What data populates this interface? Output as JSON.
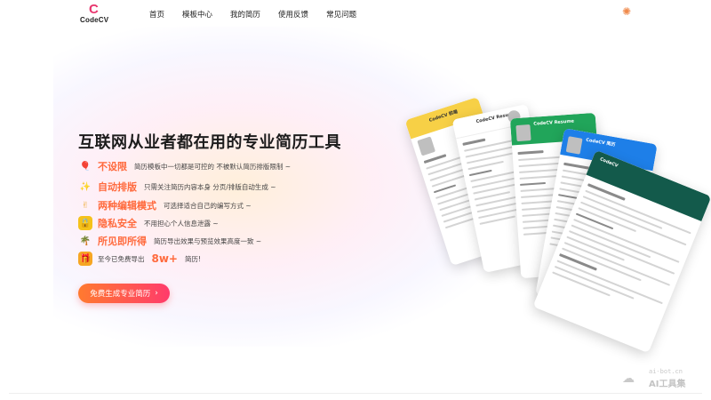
{
  "brand": {
    "logo_letter": "C",
    "logo_text": "CodeCV"
  },
  "nav": {
    "items": [
      "首页",
      "模板中心",
      "我的简历",
      "使用反馈",
      "常见问题"
    ]
  },
  "hero": {
    "headline": "互联网从业者都在用的专业简历工具",
    "features": [
      {
        "icon": "balloon-icon",
        "title": "不设限",
        "desc": "简历模板中一切都是可控的  不被默认简历排版限制 ~"
      },
      {
        "icon": "sparkles-icon",
        "title": "自动排版",
        "desc": "只需关注简历内容本身  分页/排版自动生成 ~"
      },
      {
        "icon": "peace-hand-icon",
        "title": "两种编辑模式",
        "desc": "可选择适合自己的编写方式 ~"
      },
      {
        "icon": "lock-icon",
        "title": "隐私安全",
        "desc": "不用担心个人信息泄露 ~"
      },
      {
        "icon": "palm-tree-icon",
        "title": "所见即所得",
        "desc": "简历导出效果与预览效果高度一致 ~"
      }
    ],
    "export_stat": {
      "icon": "gift-icon",
      "prefix": "至今已免费导出",
      "count": "8w+",
      "suffix": "简历!"
    },
    "cta_label": "免费生成专业简历",
    "cta_chevron": "›"
  },
  "resume_cards": [
    {
      "title": "CodeCV 前端",
      "header_color": "#f7d046",
      "header_text_color": "#333333"
    },
    {
      "title": "CodeCV Resume",
      "header_color": "#ffffff",
      "header_text_color": "#333333"
    },
    {
      "title": "CodeCV Resume",
      "header_color": "#21a55a",
      "header_text_color": "#ffffff"
    },
    {
      "title": "CodeCV 简历",
      "header_color": "#1e7fe8",
      "header_text_color": "#ffffff"
    },
    {
      "title": "CodeCV",
      "header_color": "#135a4b",
      "header_text_color": "#ffffff"
    }
  ],
  "watermark": {
    "url": "ai-bot.cn",
    "name": "AI工具集"
  },
  "colors": {
    "accent": "#ff6a3d",
    "brand": "#e8356d"
  }
}
